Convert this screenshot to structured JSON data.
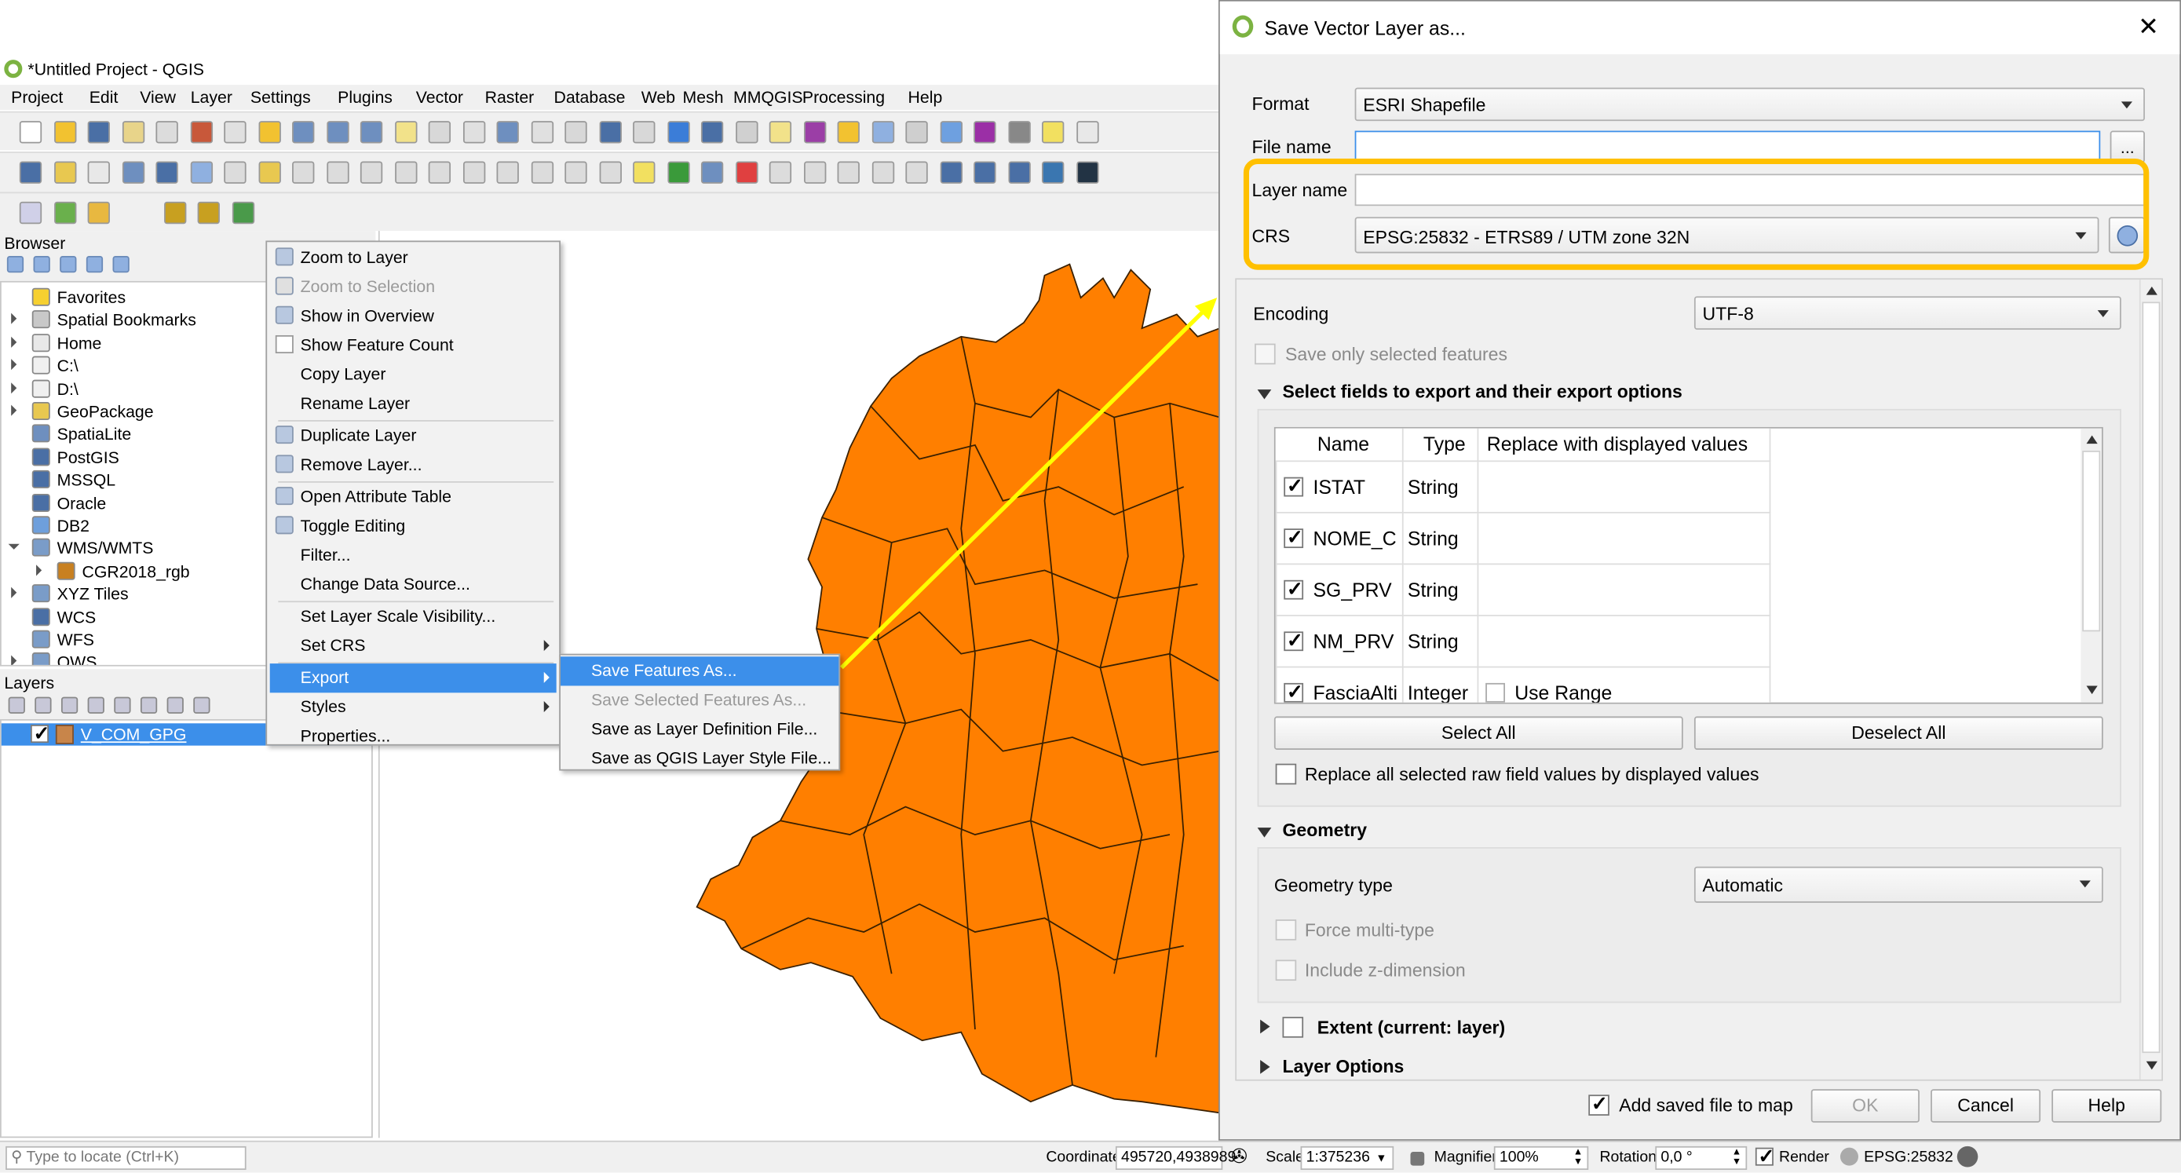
{
  "app": {
    "title": "*Untitled Project - QGIS",
    "logo_icon": "qgis-logo-icon"
  },
  "menu": [
    "Project",
    "Edit",
    "View",
    "Layer",
    "Settings",
    "Plugins",
    "Vector",
    "Raster",
    "Database",
    "Web",
    "Mesh",
    "MMQGIS",
    "Processing",
    "Help"
  ],
  "toolbars": {
    "row1": [
      {
        "name": "new-project-icon",
        "color": "#ffffff"
      },
      {
        "name": "open-project-icon",
        "color": "#f2c230"
      },
      {
        "name": "save-project-icon",
        "color": "#4a6fa5"
      },
      {
        "name": "save-as-icon",
        "color": "#e8d48a"
      },
      {
        "name": "print-layout-icon",
        "color": "#dcdcdc"
      },
      {
        "name": "style-manager-icon",
        "color": "#c8583a"
      },
      {
        "name": "pan-icon",
        "color": "#e0e0e0"
      },
      {
        "name": "pan-to-selection-icon",
        "color": "#f2c230"
      },
      {
        "name": "zoom-in-icon",
        "color": "#6e8fbf"
      },
      {
        "name": "zoom-out-icon",
        "color": "#6e8fbf"
      },
      {
        "name": "zoom-full-icon",
        "color": "#6e8fbf"
      },
      {
        "name": "zoom-to-selection-icon",
        "color": "#f2e28a"
      },
      {
        "name": "zoom-to-layer-icon",
        "color": "#d8d8d8"
      },
      {
        "name": "zoom-native-icon",
        "color": "#e0e0e0"
      },
      {
        "name": "zoom-last-icon",
        "color": "#6e8fbf"
      },
      {
        "name": "zoom-next-icon",
        "color": "#e0e0e0"
      },
      {
        "name": "new-map-view-icon",
        "color": "#d8d8d8"
      },
      {
        "name": "new-bookmark-icon",
        "color": "#4a6fa5"
      },
      {
        "name": "show-bookmarks-icon",
        "color": "#d8d8d8"
      },
      {
        "name": "refresh-icon",
        "color": "#3b7dd8"
      },
      {
        "name": "identify-icon",
        "color": "#4a6fa5"
      },
      {
        "name": "run-action-icon",
        "color": "#d0d0d0"
      },
      {
        "name": "select-features-icon",
        "color": "#f2e28a"
      },
      {
        "name": "select-by-expression-icon",
        "color": "#9b3ea6"
      },
      {
        "name": "deselect-icon",
        "color": "#f2c230"
      },
      {
        "name": "attribute-table-icon",
        "color": "#8fb0e0"
      },
      {
        "name": "field-calculator-icon",
        "color": "#cfcfcf"
      },
      {
        "name": "processing-toolbox-icon",
        "color": "#6ea0e0"
      },
      {
        "name": "statistics-icon",
        "color": "#9b2fa6"
      },
      {
        "name": "measure-icon",
        "color": "#888888"
      },
      {
        "name": "map-tips-icon",
        "color": "#f2e060"
      },
      {
        "name": "text-annotation-icon",
        "color": "#e8e8e8"
      }
    ],
    "row2": [
      {
        "name": "data-source-manager-icon",
        "color": "#4a6fa5"
      },
      {
        "name": "new-geopackage-icon",
        "color": "#e8c850"
      },
      {
        "name": "new-shapefile-icon",
        "color": "#e8e8e8"
      },
      {
        "name": "new-spatialite-icon",
        "color": "#6e8fbf"
      },
      {
        "name": "new-temporary-layer-icon",
        "color": "#4a6fa5"
      },
      {
        "name": "new-virtual-layer-icon",
        "color": "#8fb0e0"
      },
      {
        "name": "current-edits-icon",
        "color": "#dcdcdc"
      },
      {
        "name": "toggle-editing-icon",
        "color": "#e8c850"
      },
      {
        "name": "save-edits-icon",
        "color": "#dcdcdc"
      },
      {
        "name": "add-feature-icon",
        "color": "#dcdcdc"
      },
      {
        "name": "vertex-tool-icon",
        "color": "#dcdcdc"
      },
      {
        "name": "modify-attributes-icon",
        "color": "#dcdcdc"
      },
      {
        "name": "delete-selected-icon",
        "color": "#dcdcdc"
      },
      {
        "name": "cut-features-icon",
        "color": "#dcdcdc"
      },
      {
        "name": "copy-features-icon",
        "color": "#dcdcdc"
      },
      {
        "name": "paste-features-icon",
        "color": "#dcdcdc"
      },
      {
        "name": "undo-icon",
        "color": "#dcdcdc"
      },
      {
        "name": "redo-icon",
        "color": "#dcdcdc"
      },
      {
        "name": "label-tool-icon",
        "color": "#f2e060"
      },
      {
        "name": "diagram-icon",
        "color": "#3a9a3a"
      },
      {
        "name": "pin-labels-icon",
        "color": "#6e8fbf"
      },
      {
        "name": "highlight-labels-icon",
        "color": "#e04040"
      },
      {
        "name": "move-label-icon",
        "color": "#dcdcdc"
      },
      {
        "name": "rotate-label-icon",
        "color": "#dcdcdc"
      },
      {
        "name": "show-hide-labels-icon",
        "color": "#dcdcdc"
      },
      {
        "name": "change-label-icon",
        "color": "#dcdcdc"
      },
      {
        "name": "label-properties-icon",
        "color": "#dcdcdc"
      },
      {
        "name": "metasearch-icon",
        "color": "#4a6fa5"
      },
      {
        "name": "wms-search-icon",
        "color": "#4a6fa5"
      },
      {
        "name": "geocode-icon",
        "color": "#4a6fa5"
      },
      {
        "name": "python-console-icon",
        "color": "#3a76b0"
      },
      {
        "name": "globe-icon",
        "color": "#223344"
      }
    ],
    "row3": [
      {
        "name": "profile-tool-icon",
        "color": "#d0d0e8"
      },
      {
        "name": "quick-map-services-icon",
        "color": "#6ab04c"
      },
      {
        "name": "georeferencer-icon",
        "color": "#e8b840"
      },
      {
        "name": "geopackage-import-icon",
        "color": "#c8a020"
      },
      {
        "name": "geopackage-export-icon",
        "color": "#c8a020"
      },
      {
        "name": "tools-icon",
        "color": "#4a9a4a"
      }
    ]
  },
  "browser": {
    "title": "Browser",
    "tools": [
      "add-selected-icon",
      "refresh-icon",
      "filter-icon",
      "collapse-all-icon",
      "properties-info-icon"
    ],
    "items": [
      {
        "label": "Favorites",
        "icon": "star-icon",
        "color": "#f6d030",
        "expander": false,
        "indent": 0
      },
      {
        "label": "Spatial Bookmarks",
        "icon": "bookmark-icon",
        "color": "#c8c8c8",
        "expander": true,
        "indent": 0
      },
      {
        "label": "Home",
        "icon": "home-icon",
        "color": "#e8e8e8",
        "expander": true,
        "indent": 0
      },
      {
        "label": "C:\\",
        "icon": "folder-icon",
        "color": "#f0f0f0",
        "expander": true,
        "indent": 0
      },
      {
        "label": "D:\\",
        "icon": "folder-icon",
        "color": "#f0f0f0",
        "expander": true,
        "indent": 0
      },
      {
        "label": "GeoPackage",
        "icon": "geopackage-icon",
        "color": "#e8c850",
        "expander": true,
        "indent": 0
      },
      {
        "label": "SpatiaLite",
        "icon": "feather-icon",
        "color": "#6e8fbf",
        "expander": false,
        "indent": 0
      },
      {
        "label": "PostGIS",
        "icon": "elephant-icon",
        "color": "#4a6fa5",
        "expander": false,
        "indent": 0
      },
      {
        "label": "MSSQL",
        "icon": "mssql-icon",
        "color": "#4a6fa5",
        "expander": false,
        "indent": 0
      },
      {
        "label": "Oracle",
        "icon": "oracle-icon",
        "color": "#4a6fa5",
        "expander": false,
        "indent": 0
      },
      {
        "label": "DB2",
        "icon": "db2-icon",
        "color": "#6e9fdc",
        "expander": false,
        "indent": 0
      },
      {
        "label": "WMS/WMTS",
        "icon": "globe-icon",
        "color": "#7a9cc8",
        "expander": true,
        "expanded": true,
        "indent": 0
      },
      {
        "label": "CGR2018_rgb",
        "icon": "wms-layer-icon",
        "color": "#c88020",
        "expander": true,
        "indent": 1
      },
      {
        "label": "XYZ Tiles",
        "icon": "globe-icon",
        "color": "#7a9cc8",
        "expander": true,
        "indent": 0
      },
      {
        "label": "WCS",
        "icon": "globe-icon",
        "color": "#4a6fa5",
        "expander": false,
        "indent": 0
      },
      {
        "label": "WFS",
        "icon": "globe-icon",
        "color": "#7a9cc8",
        "expander": false,
        "indent": 0
      },
      {
        "label": "OWS",
        "icon": "globe-icon",
        "color": "#7a9cc8",
        "expander": true,
        "indent": 0
      }
    ]
  },
  "layers": {
    "title": "Layers",
    "tools": [
      "style-panel-icon",
      "add-group-icon",
      "manage-visibility-icon",
      "filter-legend-icon",
      "filter-by-expression-icon",
      "expand-all-icon",
      "collapse-all-icon",
      "remove-layer-icon"
    ],
    "items": [
      {
        "label": "V_COM_GPG",
        "checked": true,
        "swatch": "#c8854a"
      }
    ]
  },
  "context_menu": {
    "items": [
      {
        "label": "Zoom to Layer",
        "icon": "zoom-to-layer-icon"
      },
      {
        "label": "Zoom to Selection",
        "icon": "zoom-to-selection-icon",
        "disabled": true
      },
      {
        "label": "Show in Overview",
        "icon": "overview-glasses-icon"
      },
      {
        "label": "Show Feature Count",
        "icon": "checkbox-icon"
      },
      {
        "label": "Copy Layer"
      },
      {
        "label": "Rename Layer",
        "sep_after": true
      },
      {
        "label": "Duplicate Layer",
        "icon": "duplicate-layer-icon"
      },
      {
        "label": "Remove Layer...",
        "icon": "remove-layer-icon",
        "sep_after": true
      },
      {
        "label": "Open Attribute Table",
        "icon": "attribute-table-icon"
      },
      {
        "label": "Toggle Editing",
        "icon": "pencil-icon"
      },
      {
        "label": "Filter..."
      },
      {
        "label": "Change Data Source...",
        "sep_after": true
      },
      {
        "label": "Set Layer Scale Visibility..."
      },
      {
        "label": "Set CRS",
        "submenu": true,
        "sep_after": true
      },
      {
        "label": "Export",
        "submenu": true,
        "highlighted": true
      },
      {
        "label": "Styles",
        "submenu": true
      },
      {
        "label": "Properties..."
      }
    ],
    "export_submenu": [
      {
        "label": "Save Features As...",
        "highlighted": true
      },
      {
        "label": "Save Selected Features As...",
        "disabled": true
      },
      {
        "label": "Save as Layer Definition File..."
      },
      {
        "label": "Save as QGIS Layer Style File..."
      }
    ]
  },
  "map": {
    "fill_color": "#ff7f00",
    "annotation_color": "#ffff00",
    "highlight_color": "#ffc000"
  },
  "dialog": {
    "title": "Save Vector Layer as...",
    "format_label": "Format",
    "format_value": "ESRI Shapefile",
    "file_name_label": "File name",
    "file_name_value": "",
    "browse_label": "...",
    "layer_name_label": "Layer name",
    "layer_name_value": "",
    "crs_label": "CRS",
    "crs_value": "EPSG:25832 - ETRS89 / UTM zone 32N",
    "encoding_label": "Encoding",
    "encoding_value": "UTF-8",
    "save_selected_label": "Save only selected features",
    "fields_section": "Select fields to export and their export options",
    "table_headers": [
      "Name",
      "Type",
      "Replace with displayed values"
    ],
    "fields": [
      {
        "name": "ISTAT",
        "type": "String",
        "checked": true
      },
      {
        "name": "NOME_C",
        "type": "String",
        "checked": true
      },
      {
        "name": "SG_PRV",
        "type": "String",
        "checked": true
      },
      {
        "name": "NM_PRV",
        "type": "String",
        "checked": true
      },
      {
        "name": "FasciaAlti",
        "type": "Integer",
        "checked": true,
        "replace": "Use Range"
      }
    ],
    "select_all": "Select All",
    "deselect_all": "Deselect All",
    "replace_all_label": "Replace all selected raw field values by displayed values",
    "geometry_section": "Geometry",
    "geometry_type_label": "Geometry type",
    "geometry_type_value": "Automatic",
    "force_multi_label": "Force multi-type",
    "include_z_label": "Include z-dimension",
    "extent_section": "Extent (current: layer)",
    "layer_options_section": "Layer Options",
    "add_saved_label": "Add saved file to map",
    "add_saved_checked": true,
    "ok": "OK",
    "cancel": "Cancel",
    "help": "Help"
  },
  "statusbar": {
    "locate_placeholder": "Type to locate (Ctrl+K)",
    "coordinate_label": "Coordinate",
    "coordinate_value": "495720,4938989",
    "scale_label": "Scale",
    "scale_value": "1:375236",
    "magnifier_label": "Magnifier",
    "magnifier_value": "100%",
    "rotation_label": "Rotation",
    "rotation_value": "0,0 °",
    "render_label": "Render",
    "render_checked": true,
    "crs_value": "EPSG:25832"
  }
}
